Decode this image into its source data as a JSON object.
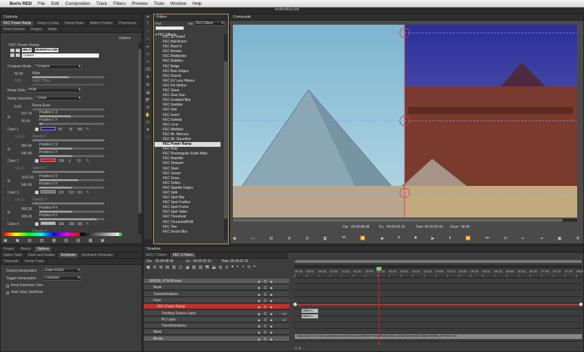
{
  "menubar": {
    "app": "Boris RED",
    "items": [
      "File",
      "Edit",
      "Composition",
      "Track",
      "Filters",
      "Preview",
      "Tools",
      "Window",
      "Help"
    ]
  },
  "window_title": "motionKey.red",
  "controls": {
    "title": "Controls",
    "tabs_row1": [
      "FEC Power Ramp",
      "Ramp Cycling",
      "Ramp Noise",
      "Motion Tracker",
      "Preprocess"
    ],
    "tabs_row2": [
      "Pixel Chooser",
      "Region",
      "Matte"
    ],
    "options_label": "Options",
    "filter_name": "FEC Power Ramp",
    "help_label": "HELP",
    "url": "BORISFX.COM",
    "current_label": "Current",
    "compare_mode_label": "Compare Mode",
    "compare_mode_value": "Compare",
    "wipe_value": "50.00",
    "wipe_label": "Wipe",
    "right_offset_value": "0.00",
    "right_offset_label": "Right Offset",
    "ramp_style_label": "Ramp Style",
    "ramp_style_value": "RGB",
    "ramp_geometry_label": "Ramp Geometry",
    "ramp_geometry_value": "Linear",
    "ramp_ease_value": "0.00",
    "ramp_ease_label": "Ramp Ease",
    "pos1x": "917.75",
    "pos1x_label": "Position 1 X",
    "pos1y": "55.59",
    "pos1y_label": "Position 1 Y",
    "color1_label": "Color 1",
    "color1_rgb": [
      "45",
      "18",
      "150"
    ],
    "color1_hex": "#2d1296",
    "opacity1_value": "100.00",
    "opacity1_label": "Opacity 1",
    "pos2x": "960.00",
    "pos2x_label": "Position 2 X",
    "pos2y": "540.00",
    "pos2y_label": "Position 2 Y",
    "color2_label": "Color 2",
    "color2_rgb": [
      "239",
      "3",
      "31"
    ],
    "color2_hex": "#ef031f",
    "opacity2_value": "100.00",
    "opacity2_label": "Opacity 2",
    "pos3x": "1152.00",
    "pos3x_label": "Position 3 X",
    "pos3y": "540.00",
    "pos3y_label": "Position 3 Y",
    "color3_label": "Color 3",
    "color3_rgb": [
      "113",
      "113",
      "113"
    ],
    "color3_hex": "#717171",
    "opacity3_value": "100.00",
    "opacity3_label": "Opacity 3",
    "pos4x": "958.28",
    "pos4x_label": "Position 4 X",
    "pos4y": "945.00",
    "pos4y_label": "Position 4 Y",
    "color4_label": "Color 4",
    "color4_rgb": [
      "185",
      "185",
      "185"
    ],
    "color4_hex": "#b9b9b9",
    "opacity4_label": "Opacity 4"
  },
  "filters": {
    "title": "Filters",
    "find_label": "Find",
    "set_label": "Set",
    "set_value": "FEC Filters",
    "group": "FEC Effects",
    "items": [
      "FEC 3D Relief",
      "FEC Ball Action",
      "FEC Band It",
      "FEC Bender",
      "FEC Blobbylize",
      "FEC Bubbles",
      "FEC Bulge",
      "FEC Burn Edges",
      "FEC Drizzle",
      "FEC EZ Lazy Waves",
      "FEC Flo Motion",
      "FEC Glass",
      "FEC Glue Gun",
      "FEC Gradient Blur",
      "FEC Griddler",
      "FEC Hair",
      "FEC Invert",
      "FEC Kaleida",
      "FEC Lens",
      "FEC MiniMax",
      "FEC Mr. Mercury",
      "FEC Mr. Smoothie",
      "FEC Power Ramp",
      "FEC Rain",
      "FEC Rectangular Scale Wipe",
      "FEC Repetile",
      "FEC Sharpen",
      "FEC Slant",
      "FEC Smear",
      "FEC Snow",
      "FEC Soften",
      "FEC Sparkle Edges",
      "FEC Split",
      "FEC Spot Blur",
      "FEC Spot Feather",
      "FEC Spot Frame",
      "FEC Spot Tatter",
      "FEC Threshold",
      "FEC ThresholdRGB",
      "FEC Tiler",
      "FEC Vector Blur"
    ],
    "selected": "FEC Power Ramp"
  },
  "composite": {
    "title": "Composite",
    "dur_label": "Dur",
    "dur": "00:00:08:08",
    "ev_label": "Ev.",
    "ev": "00:00:02:10",
    "time_label": "Time",
    "time": "00:00:02:10",
    "zoom_label": "Zoom",
    "zoom": "58.98"
  },
  "lower_left": {
    "tabs_row1": [
      "Project",
      "History",
      "Options"
    ],
    "tabs_row2": [
      "Spline Tools",
      "Grids and Guides",
      "Keyframe",
      "Keyframe Generator"
    ],
    "tabs_row3": [
      "Timecode",
      "Vector Track"
    ],
    "default_interp_label": "Default Interpolation",
    "default_interp_value": "Ease In/Out",
    "toggle_interp_label": "Toggle Interpolation",
    "toggle_interp_value": "Constant",
    "keep_kf_label": "Keep Keyframe Time",
    "hold_value_label": "Hold Value Start/End"
  },
  "timeline": {
    "title": "Timeline",
    "tabs": [
      "BCC 7 Filters",
      "FEC 5 Filters"
    ],
    "dur_label": "Dur.",
    "dur": "00:00:08:08",
    "ev_label": "Ev.",
    "ev": "00:00:02:10",
    "time_label": "Time",
    "time": "00:00:02:10",
    "ruler": [
      "00:00",
      "00:10",
      "00:20",
      "01:00",
      "01:10",
      "01:20",
      "02:00",
      "02:10",
      "02:20",
      "03:00",
      "03:10",
      "03:20",
      "04:00",
      "04:10",
      "04:20",
      "05:00",
      "05:10",
      "05:20",
      "06:00",
      "06:10",
      "06:20",
      "07:00",
      "07:10",
      "07:20",
      "08:00"
    ],
    "tracks": [
      {
        "label": "000599_VTXHD.mov",
        "indent": 0,
        "style": "head"
      },
      {
        "label": "Mask",
        "indent": 1,
        "style": "sub"
      },
      {
        "label": "Transformations",
        "indent": 1,
        "style": "sub"
      },
      {
        "label": "Face",
        "indent": 1,
        "style": "sub"
      },
      {
        "label": "FEC Power Ramp",
        "indent": 2,
        "style": "red"
      },
      {
        "label": "Tracking Source Layer",
        "indent": 3,
        "style": "sub"
      },
      {
        "label": "PC Layer",
        "indent": 3,
        "style": "sub"
      },
      {
        "label": "Transformations",
        "indent": 3,
        "style": "sub"
      },
      {
        "label": "Mask",
        "indent": 1,
        "style": "sub"
      },
      {
        "label": "Media",
        "indent": 1,
        "style": "media"
      }
    ],
    "track_tag1": "V1",
    "track_tag2": "V1",
    "clip_video1a": "Video 1",
    "clip_video1b": "Video 1",
    "media_path": "Macintosh HD:Users:petermeyers:Desktop:BorisRED:PowerRamp/2011.Media:WebVideoClips:000599_VTXHD.mov"
  },
  "colors": {
    "accent_red": "#c4302b",
    "playhead": "#e02020",
    "tab_blue": "#3a6fb5"
  }
}
